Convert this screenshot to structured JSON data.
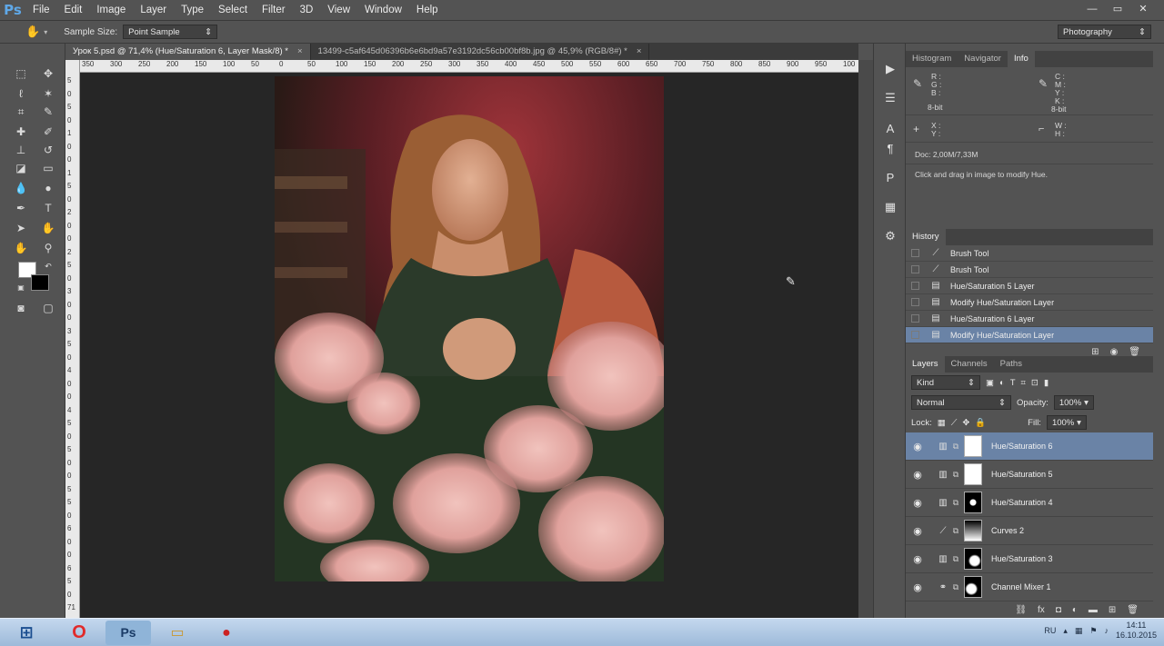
{
  "app": {
    "logo": "Ps",
    "workspace": "Photography"
  },
  "menu": [
    "File",
    "Edit",
    "Image",
    "Layer",
    "Type",
    "Select",
    "Filter",
    "3D",
    "View",
    "Window",
    "Help"
  ],
  "window_controls": {
    "minimize": "—",
    "restore": "▭",
    "close": "✕"
  },
  "options": {
    "sample_size_label": "Sample Size:",
    "sample_size_value": "Point Sample"
  },
  "doc_tabs": [
    {
      "label": "Урок 5.psd @ 71,4% (Hue/Saturation 6, Layer Mask/8) *",
      "close": "×"
    },
    {
      "label": "13499-c5af645d06396b6e6bd9a57e3192dc56cb00bf8b.jpg @ 45,9% (RGB/8#) *",
      "close": "×"
    }
  ],
  "ruler_top": [
    "350",
    "300",
    "250",
    "200",
    "150",
    "100",
    "50",
    "0",
    "50",
    "100",
    "150",
    "200",
    "250",
    "300",
    "350",
    "400",
    "450",
    "500",
    "550",
    "600",
    "650",
    "700",
    "750",
    "800",
    "850",
    "900",
    "950",
    "100"
  ],
  "ruler_left": [
    "5",
    "0",
    "5",
    "0",
    "1",
    "0",
    "0",
    "1",
    "5",
    "0",
    "2",
    "0",
    "0",
    "2",
    "5",
    "0",
    "3",
    "0",
    "0",
    "3",
    "5",
    "0",
    "4",
    "0",
    "0",
    "4",
    "5",
    "0",
    "5",
    "0",
    "0",
    "5",
    "5",
    "0",
    "6",
    "0",
    "0",
    "6",
    "5",
    "0",
    "71"
  ],
  "info_panel": {
    "tabs": [
      "Histogram",
      "Navigator",
      "Info"
    ],
    "rgb_labels": [
      "R :",
      "G :",
      "B :"
    ],
    "cmyk_labels": [
      "C :",
      "M :",
      "Y :",
      "K :"
    ],
    "bitdepth_left": "8-bit",
    "bitdepth_right": "8-bit",
    "xy_labels": [
      "X :",
      "Y :"
    ],
    "wh_labels": [
      "W :",
      "H :"
    ],
    "doc_size": "Doc: 2,00M/7,33M",
    "hint": "Click and drag in image to modify Hue."
  },
  "history": {
    "tab": "History",
    "items": [
      "Brush Tool",
      "Brush Tool",
      "Hue/Saturation 5 Layer",
      "Modify Hue/Saturation Layer",
      "Hue/Saturation 6 Layer",
      "Modify Hue/Saturation Layer"
    ]
  },
  "layers": {
    "tabs": [
      "Layers",
      "Channels",
      "Paths"
    ],
    "kind": "Kind",
    "blend": "Normal",
    "opacity_label": "Opacity:",
    "opacity_value": "100%",
    "lock_label": "Lock:",
    "fill_label": "Fill:",
    "fill_value": "100%",
    "items": [
      "Hue/Saturation 6",
      "Hue/Saturation 5",
      "Hue/Saturation 4",
      "Curves 2",
      "Hue/Saturation 3",
      "Channel Mixer 1"
    ]
  },
  "taskbar": {
    "lang": "RU",
    "time": "14:11",
    "date": "16.10.2015"
  }
}
